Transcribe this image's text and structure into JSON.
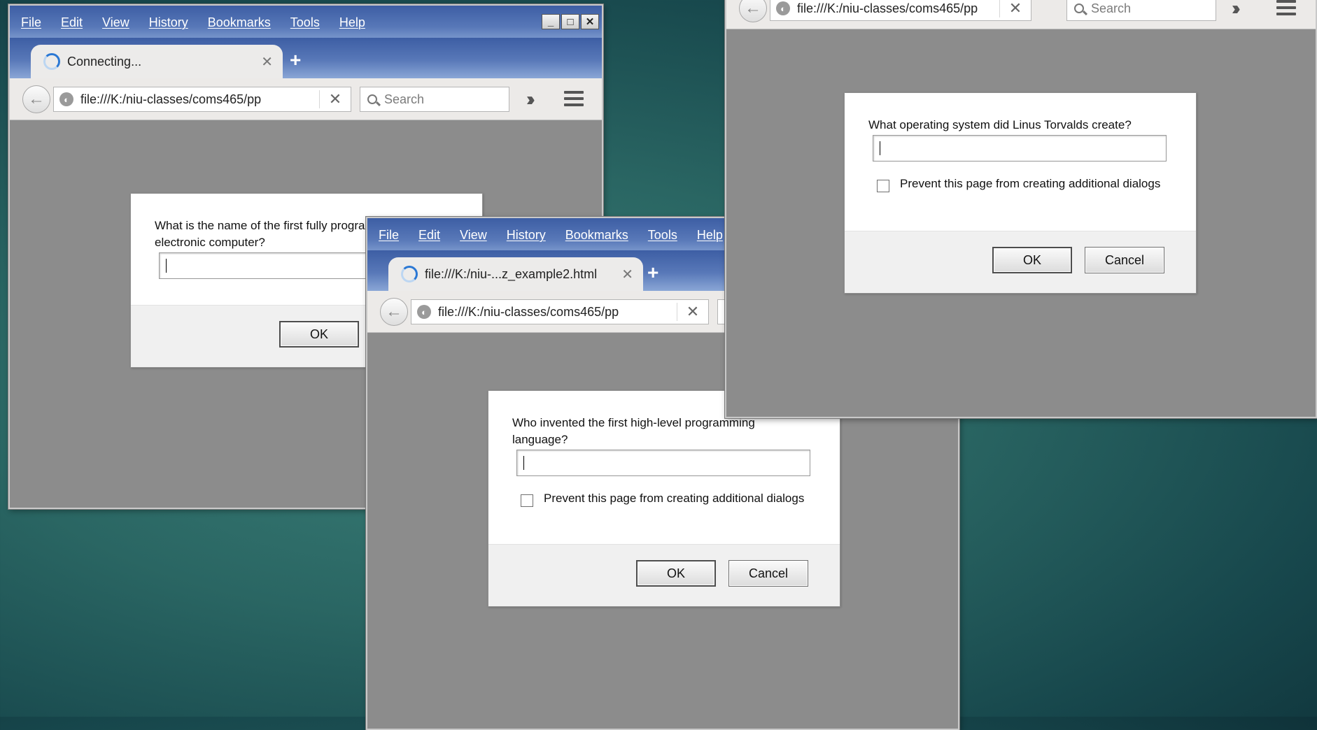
{
  "menu": [
    "File",
    "Edit",
    "View",
    "History",
    "Bookmarks",
    "Tools",
    "Help"
  ],
  "window_controls": {
    "minimize": "_",
    "maximize": "□",
    "close": "✕"
  },
  "icons": {
    "back": "arrow-left",
    "globe": "globe",
    "close": "x",
    "new_tab": "plus",
    "search": "magnifier",
    "overflow": "double-chevron",
    "menu": "hamburger"
  },
  "windows": {
    "left": {
      "tab_title": "Connecting...",
      "url": "file:///K:/niu-classes/coms465/pp",
      "search_placeholder": "Search",
      "dialog": {
        "question": "What is the name of the first fully programmable electronic computer?",
        "input_value": "",
        "ok": "OK"
      }
    },
    "middle": {
      "tab_title": "file:///K:/niu-...z_example2.html",
      "url": "file:///K:/niu-classes/coms465/pp",
      "dialog": {
        "question": "Who invented the first high-level programming language?",
        "input_value": "",
        "checkbox_label": "Prevent this page from creating additional dialogs",
        "checkbox_checked": false,
        "ok": "OK",
        "cancel": "Cancel"
      }
    },
    "right": {
      "url": "file:///K:/niu-classes/coms465/pp",
      "search_placeholder": "Search",
      "dialog": {
        "question": "What operating system did Linus Torvalds create?",
        "input_value": "",
        "checkbox_label": "Prevent this page from creating additional dialogs",
        "checkbox_checked": false,
        "ok": "OK",
        "cancel": "Cancel"
      }
    }
  }
}
